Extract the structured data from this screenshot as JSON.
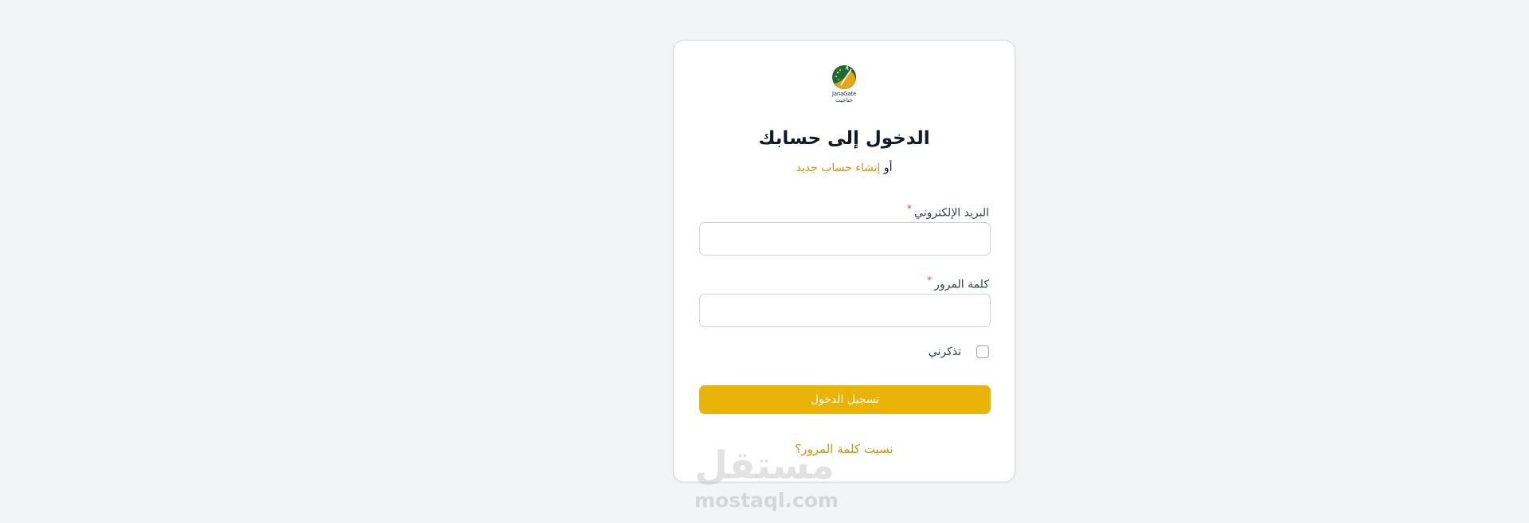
{
  "logo": {
    "name_en": "JanaGate",
    "name_ar": "جناجيت"
  },
  "login": {
    "title": "الدخول إلى حسابك",
    "or_text": "أو",
    "create_account_link": "إنشاء حساب جديد",
    "email_label": "البريد الإلكتروني",
    "email_value": "",
    "password_label": "كلمة المرور",
    "password_value": "",
    "required_mark": "*",
    "remember_label": "تذكرني",
    "remember_checked": false,
    "submit_label": "تسجيل الدخول",
    "forgot_link": "نسيت كلمة المرور؟"
  },
  "watermark": {
    "text_ar": "مستقل",
    "text_en": "mostaql.com"
  },
  "colors": {
    "accent": "#eab308",
    "link": "#d4920a",
    "required": "#ef4444",
    "background": "#f3f4f6",
    "logo_green": "#1f6b2e"
  }
}
